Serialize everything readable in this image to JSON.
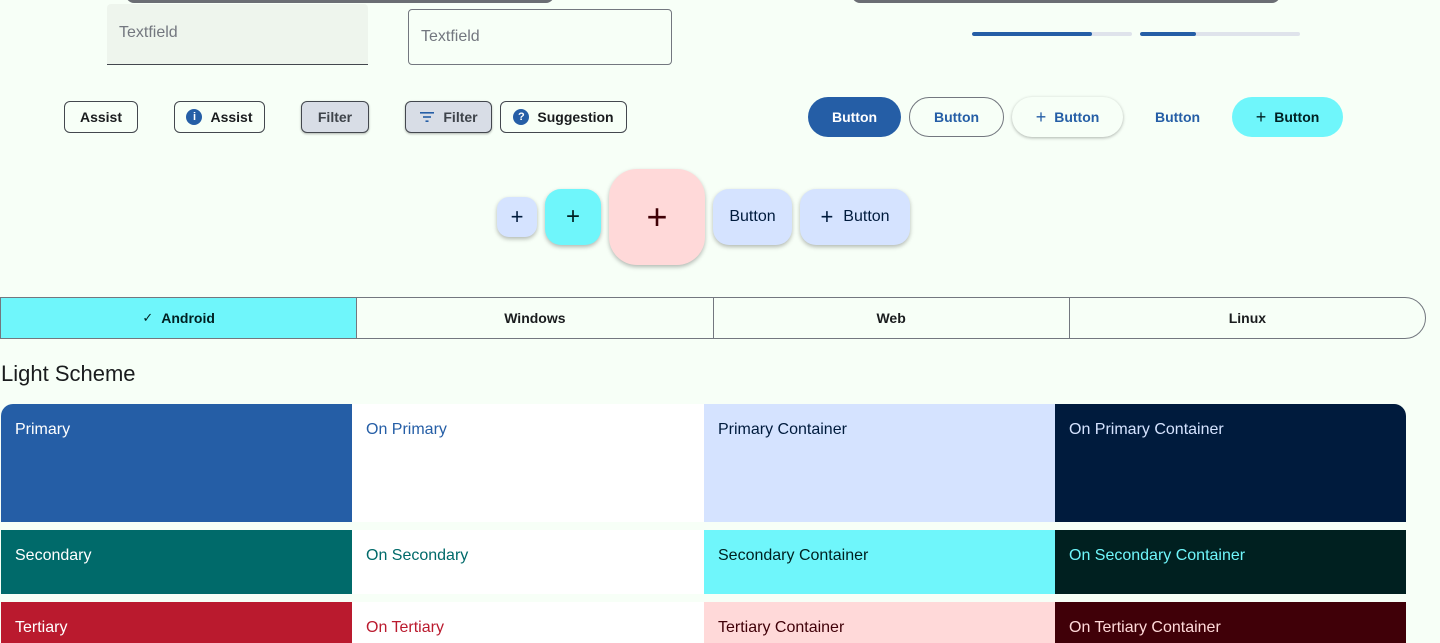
{
  "textfields": {
    "filled_placeholder": "Textfield",
    "outlined_placeholder": "Textfield"
  },
  "progress": [
    {
      "value": 0.75
    },
    {
      "value": 0.35
    }
  ],
  "chips": {
    "assist1": "Assist",
    "assist2": "Assist",
    "filter1": "Filter",
    "filter2": "Filter",
    "suggestion": "Suggestion",
    "info_icon_glyph": "i",
    "help_icon_glyph": "?"
  },
  "buttons": {
    "filled": "Button",
    "outlined": "Button",
    "elevated": "Button",
    "text": "Button",
    "tonal": "Button"
  },
  "fabs": {
    "extended1": "Button",
    "extended2": "Button"
  },
  "segmented": [
    {
      "label": "Android",
      "selected": true
    },
    {
      "label": "Windows",
      "selected": false
    },
    {
      "label": "Web",
      "selected": false
    },
    {
      "label": "Linux",
      "selected": false
    }
  ],
  "scheme": {
    "title": "Light Scheme",
    "rows": [
      [
        {
          "label": "Primary",
          "bg": "#255ea6",
          "fg": "#ffffff"
        },
        {
          "label": "On Primary",
          "bg": "#ffffff",
          "fg": "#255ea6"
        },
        {
          "label": "Primary Container",
          "bg": "#d5e3ff",
          "fg": "#001b3d"
        },
        {
          "label": "On Primary Container",
          "bg": "#001b3d",
          "fg": "#d5e3ff"
        }
      ],
      [
        {
          "label": "Secondary",
          "bg": "#006a6a",
          "fg": "#ffffff"
        },
        {
          "label": "On Secondary",
          "bg": "#ffffff",
          "fg": "#006a6a"
        },
        {
          "label": "Secondary Container",
          "bg": "#6ff6fb",
          "fg": "#002020"
        },
        {
          "label": "On Secondary Container",
          "bg": "#002020",
          "fg": "#6ff6fb"
        }
      ],
      [
        {
          "label": "Tertiary",
          "bg": "#ba1a2e",
          "fg": "#ffffff"
        },
        {
          "label": "On Tertiary",
          "bg": "#ffffff",
          "fg": "#ba1a2e"
        },
        {
          "label": "Tertiary Container",
          "bg": "#ffd9d9",
          "fg": "#400008"
        },
        {
          "label": "On Tertiary Container",
          "bg": "#400008",
          "fg": "#ffd9d9"
        }
      ]
    ]
  },
  "colors": {
    "background": "#f7fff7",
    "primary": "#255ea6",
    "secondary_container": "#6ff6fb"
  },
  "icons": {
    "add": "+",
    "check": "✓"
  }
}
